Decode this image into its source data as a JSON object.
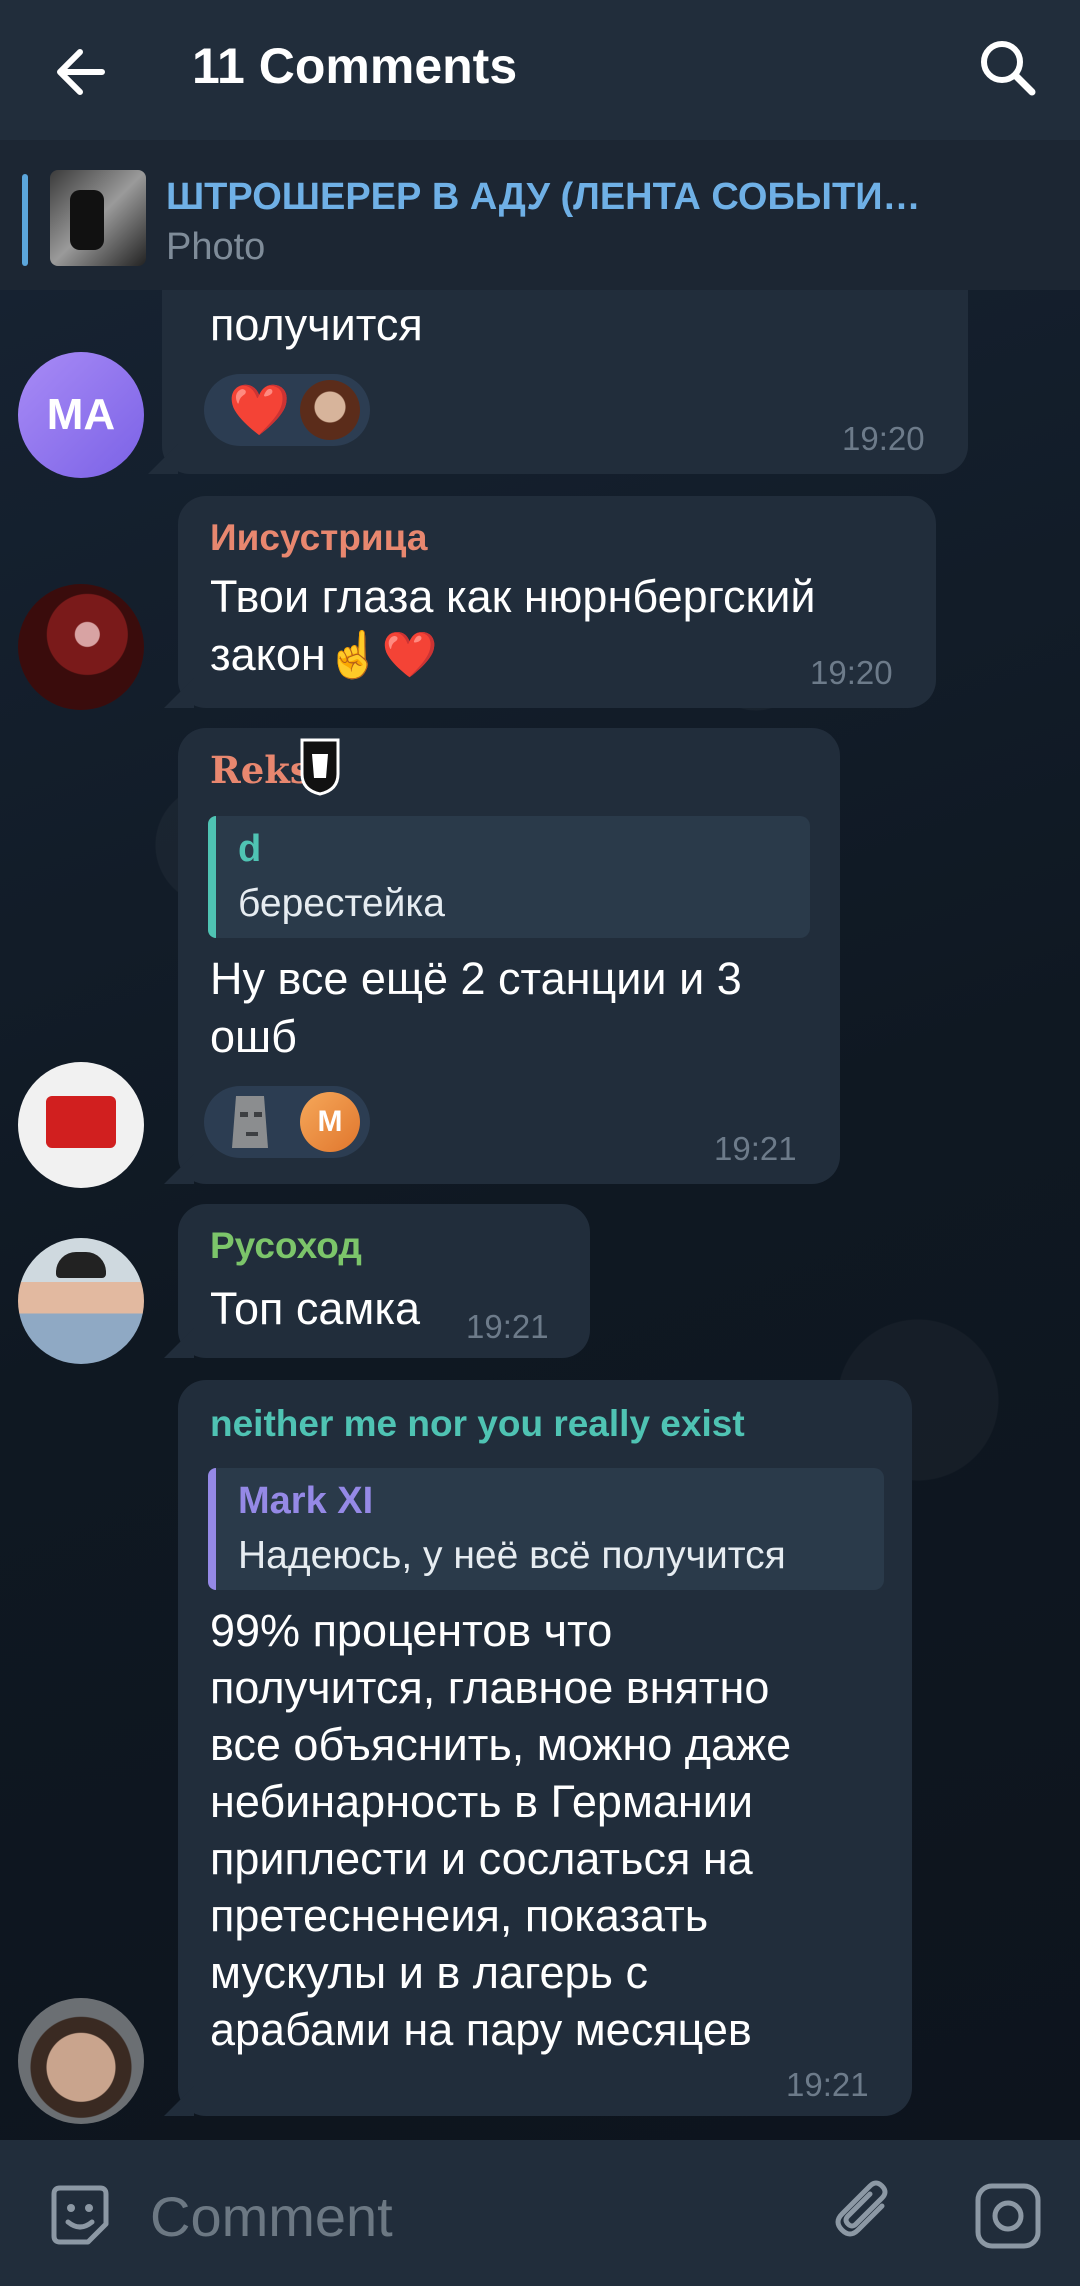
{
  "header": {
    "title": "11 Comments",
    "back_icon": "arrow-left-icon",
    "search_icon": "search-icon"
  },
  "pinned": {
    "title": "ШТРОШЕРЕР В АДУ (ЛЕНТА СОБЫТИ…",
    "subtitle": "Photo"
  },
  "messages": [
    {
      "avatar_text": "MA",
      "text": "получится",
      "time": "19:20",
      "reaction": "❤️"
    },
    {
      "sender": "Иисустрица",
      "sender_color": "#e8876f",
      "text_line1": "Твои глаза как нюрнбергский",
      "text_line2": "закон☝️❤️",
      "time": "19:20"
    },
    {
      "sender": "Reks",
      "sender_color": "#e8876f",
      "reply_name": "d",
      "reply_text": "берестейка",
      "reply_color": "#4fc3b3",
      "text_line1": "Ну все ещё 2 станции и 3",
      "text_line2": "ошб",
      "time": "19:21",
      "reaction_m": "M"
    },
    {
      "sender": "Русоход",
      "sender_color": "#7cc56a",
      "text": "Топ самка",
      "time": "19:21"
    },
    {
      "sender": "neither me nor you really exist",
      "sender_color": "#4fc3b3",
      "reply_name": "Mark XI",
      "reply_text": "Надеюсь, у неё всё получится",
      "reply_color": "#9589e6",
      "lines": [
        "99% процентов  что",
        "получится, главное внятно",
        "все объяснить,  можно даже",
        "небинарность в Германии",
        "приплести и сослаться на",
        "претесненеия,  показать",
        "мускулы и в лагерь с",
        "арабами на пару месяцев"
      ],
      "time": "19:21"
    }
  ],
  "input": {
    "placeholder": "Comment"
  }
}
